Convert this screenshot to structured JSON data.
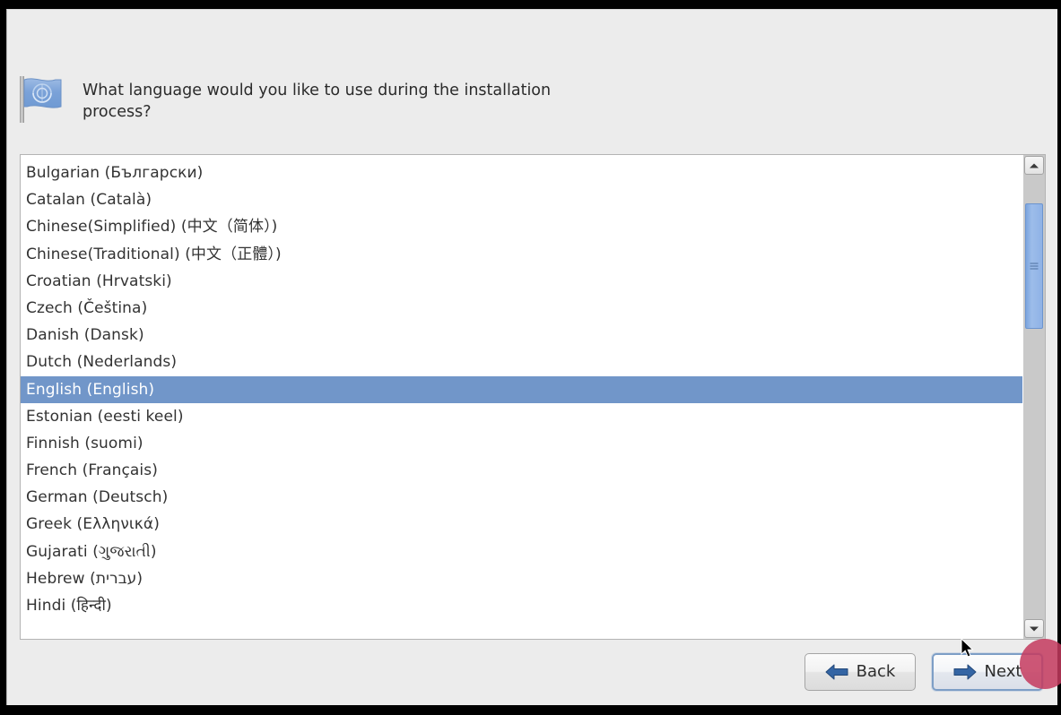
{
  "window": {
    "background_color": "#ececec",
    "frame_color": "#000000"
  },
  "header": {
    "icon": "flag-icon",
    "question": "What language would you like to use during the installation process?"
  },
  "language_list": {
    "selected": "English (English)",
    "items": [
      "Bulgarian (Български)",
      "Catalan (Català)",
      "Chinese(Simplified) (中文（简体）)",
      "Chinese(Traditional) (中文（正體）)",
      "Croatian (Hrvatski)",
      "Czech (Čeština)",
      "Danish (Dansk)",
      "Dutch (Nederlands)",
      "English (English)",
      "Estonian (eesti keel)",
      "Finnish (suomi)",
      "French (Français)",
      "German (Deutsch)",
      "Greek (Ελληνικά)",
      "Gujarati (ગુજરાતી)",
      "Hebrew (עברית)",
      "Hindi (हिन्दी)"
    ],
    "highlight_color": "#7196c9",
    "background_color": "#ffffff"
  },
  "scrollbar": {
    "up_arrow": "chevron-up-icon",
    "down_arrow": "chevron-down-icon",
    "thumb_color": "#8fb2e6",
    "track_color": "#c9c9c9"
  },
  "buttons": {
    "back": {
      "label": "Back",
      "icon": "arrow-left-icon",
      "focused": false
    },
    "next": {
      "label": "Next",
      "icon": "arrow-right-icon",
      "focused": true
    },
    "arrow_color": "#3465a4"
  },
  "cursor": {
    "type": "arrow-pointer"
  }
}
